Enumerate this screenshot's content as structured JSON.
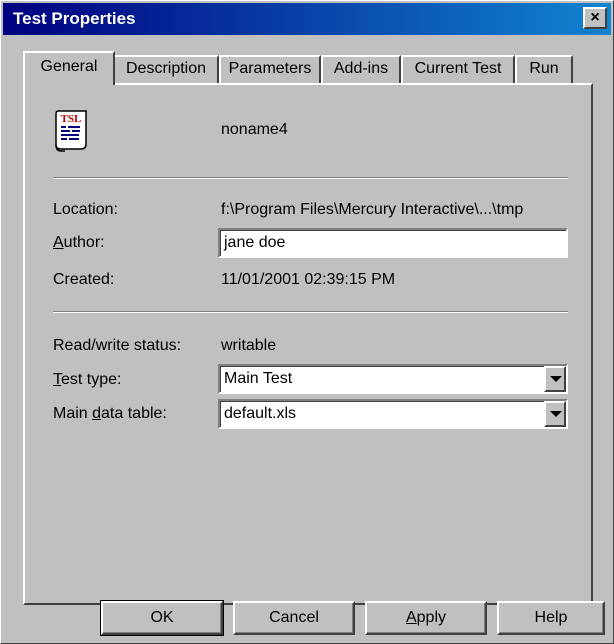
{
  "window": {
    "title": "Test Properties",
    "close_glyph": "×"
  },
  "tabs": [
    {
      "label": "General"
    },
    {
      "label": "Description"
    },
    {
      "label": "Parameters"
    },
    {
      "label": "Add-ins"
    },
    {
      "label": "Current Test"
    },
    {
      "label": "Run"
    }
  ],
  "general": {
    "icon": "tsl-script-icon",
    "icon_text": "TSL",
    "test_name": "noname4",
    "location_label": "Location:",
    "location_value": "f:\\Program Files\\Mercury Interactive\\...\\tmp",
    "author_label_pre": "",
    "author_label_u": "A",
    "author_label_post": "uthor:",
    "author_value": "jane doe",
    "created_label": "Created:",
    "created_value": "11/01/2001 02:39:15 PM",
    "rw_label": "Read/write status:",
    "rw_value": "writable",
    "testtype_label_u": "T",
    "testtype_label_post": "est type:",
    "testtype_value": "Main Test",
    "datatable_label_pre": "Main ",
    "datatable_label_u": "d",
    "datatable_label_post": "ata table:",
    "datatable_value": "default.xls"
  },
  "buttons": {
    "ok": "OK",
    "cancel": "Cancel",
    "apply_u": "A",
    "apply_rest": "pply",
    "help": "Help"
  }
}
